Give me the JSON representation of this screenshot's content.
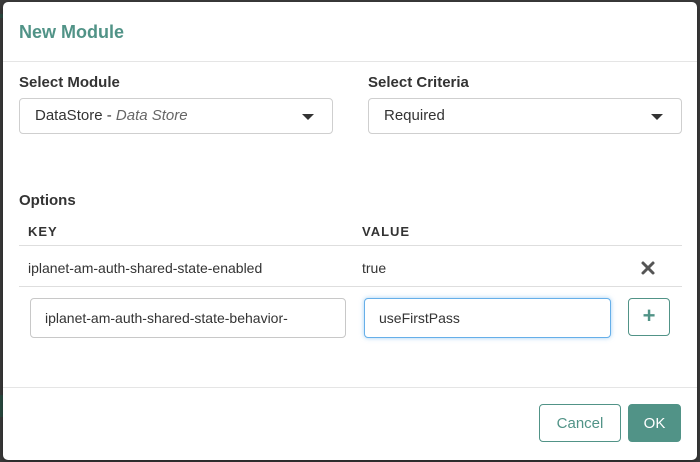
{
  "modal": {
    "title": "New Module"
  },
  "select_module": {
    "label": "Select Module",
    "value_name": "DataStore",
    "value_separator": " - ",
    "value_description": "Data Store"
  },
  "select_criteria": {
    "label": "Select Criteria",
    "value": "Required"
  },
  "options": {
    "label": "Options",
    "columns": {
      "key": "KEY",
      "value": "VALUE"
    },
    "rows": [
      {
        "key": "iplanet-am-auth-shared-state-enabled",
        "value": "true"
      }
    ],
    "new_entry": {
      "key": "iplanet-am-auth-shared-state-behavior-",
      "value": "useFirstPass"
    }
  },
  "footer": {
    "cancel_label": "Cancel",
    "ok_label": "OK"
  },
  "colors": {
    "accent": "#519387",
    "focus": "#66afe9"
  },
  "icons": {
    "remove": "close-icon",
    "add": "plus-icon",
    "dropdown": "chevron-down-icon"
  }
}
